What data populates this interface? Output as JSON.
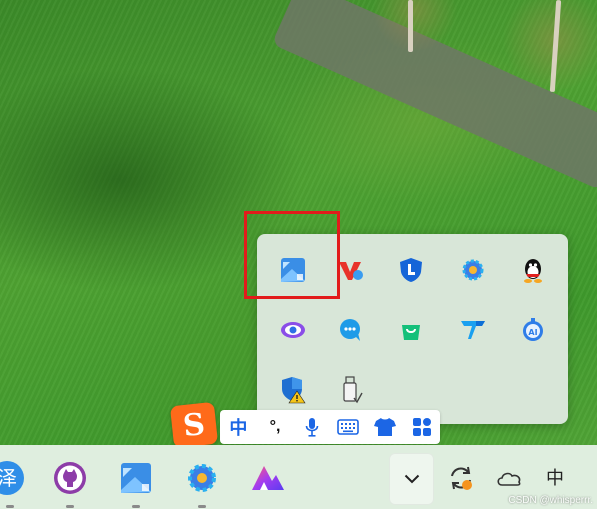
{
  "tray_flyout": {
    "icons": [
      {
        "name": "image-app-icon",
        "highlighted": true
      },
      {
        "name": "vpn-v-icon"
      },
      {
        "name": "shield-l-icon"
      },
      {
        "name": "gear-app-icon"
      },
      {
        "name": "qq-penguin-icon"
      },
      {
        "name": "eye-swirl-icon"
      },
      {
        "name": "chat-bubble-icon"
      },
      {
        "name": "shopping-bag-icon"
      },
      {
        "name": "v-logo-icon"
      },
      {
        "name": "ai-robot-icon"
      },
      {
        "name": "windows-defender-warning-icon"
      },
      {
        "name": "usb-drive-icon"
      }
    ]
  },
  "ime_toolbar": {
    "logo_letter": "S",
    "mode_label": "中",
    "punct_label": "°,",
    "icons": [
      "microphone-icon",
      "keyboard-icon",
      "shirt-skin-icon",
      "toolbox-icon"
    ]
  },
  "taskbar": {
    "apps": [
      "partial-app-icon",
      "github-icon",
      "image-app-icon",
      "gear-app-icon",
      "triangle-logo-icon"
    ],
    "overflow_icon": "chevron-down-icon",
    "tray_icons": [
      "sync-icon",
      "onedrive-cloud-icon"
    ],
    "ime_mode": "中",
    "partial_app_glyph": "泽"
  },
  "watermark": "CSDN @whisperrr.",
  "colors": {
    "highlight": "#e21b1b",
    "panel_bg": "#d8e6d8",
    "taskbar_bg": "#dfeedf",
    "ime_accent": "#ff6a1a",
    "ime_blue": "#1c66e5"
  }
}
